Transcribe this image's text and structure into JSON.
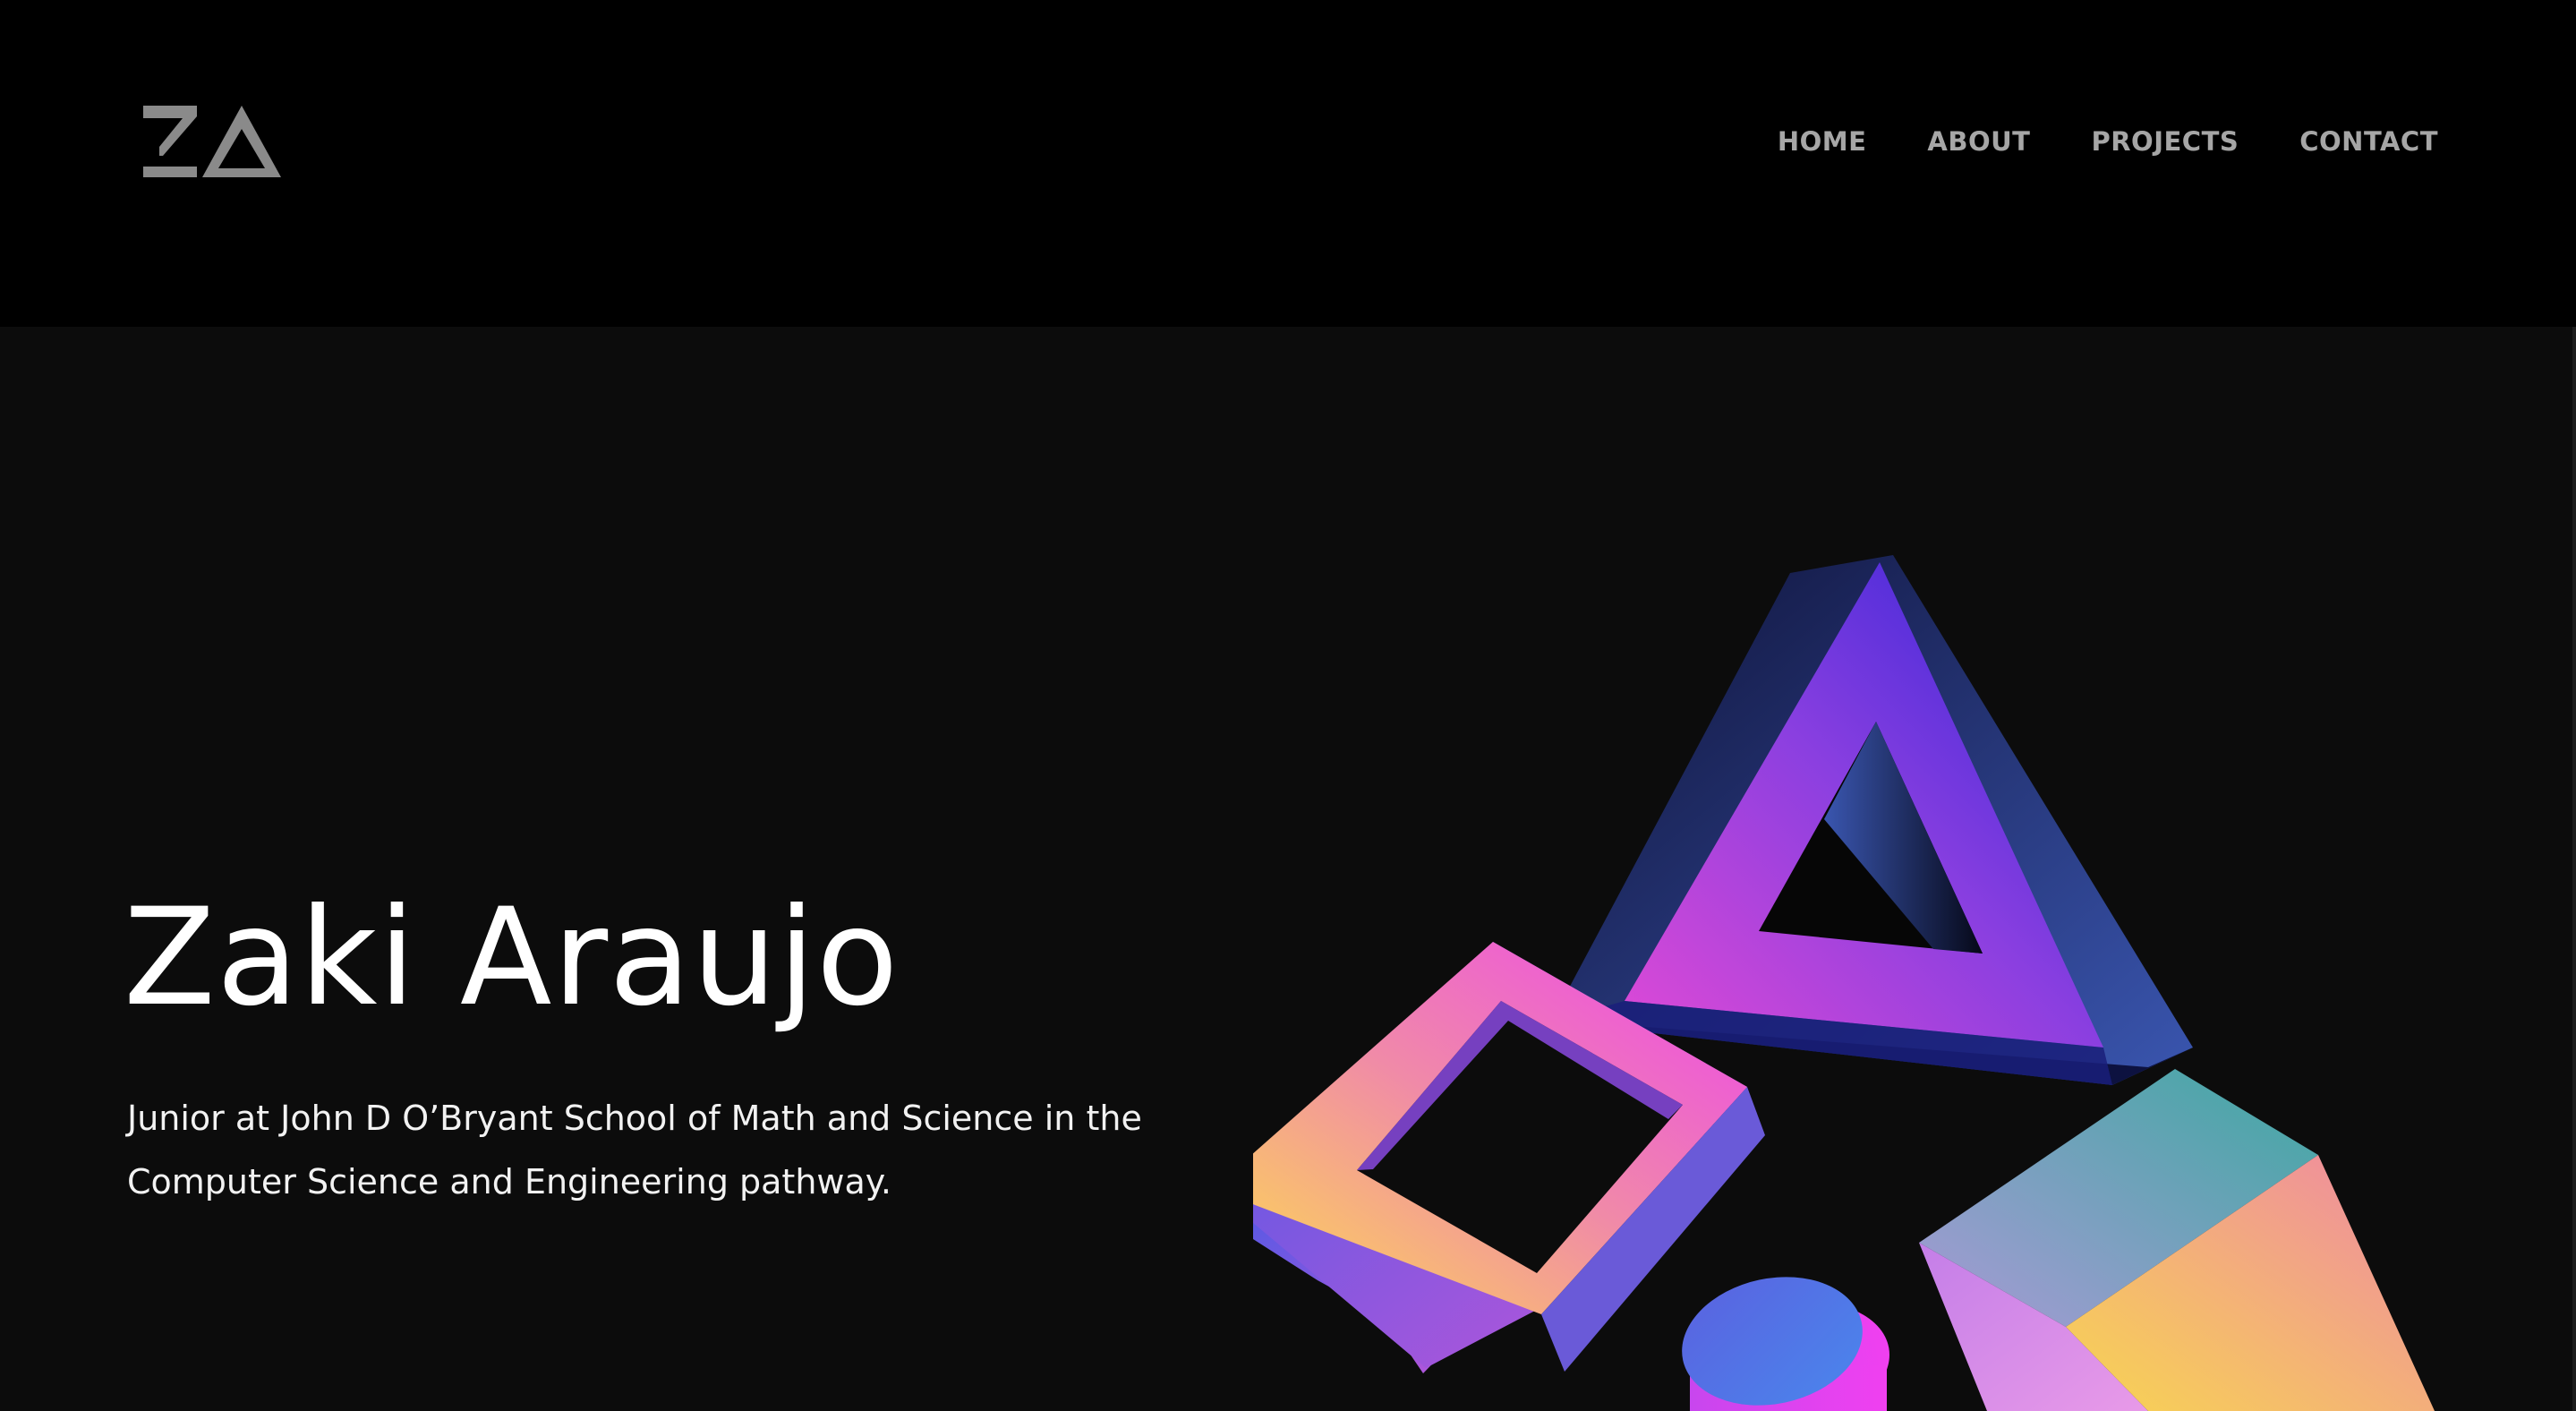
{
  "header": {
    "logo_alt": "ZA"
  },
  "nav": {
    "items": [
      {
        "label": "HOME"
      },
      {
        "label": "ABOUT"
      },
      {
        "label": "PROJECTS"
      },
      {
        "label": "CONTACT"
      }
    ]
  },
  "hero": {
    "title": "Zaki Araujo",
    "subtitle": "Junior at John D O’Bryant School of Math and Science in the Computer Science and Engineering pathway."
  },
  "colors": {
    "header_bg": "#000000",
    "hero_bg": "#0c0c0c",
    "nav_text": "#a6a6a6",
    "logo": "#8a8a8a",
    "title": "#ffffff"
  }
}
